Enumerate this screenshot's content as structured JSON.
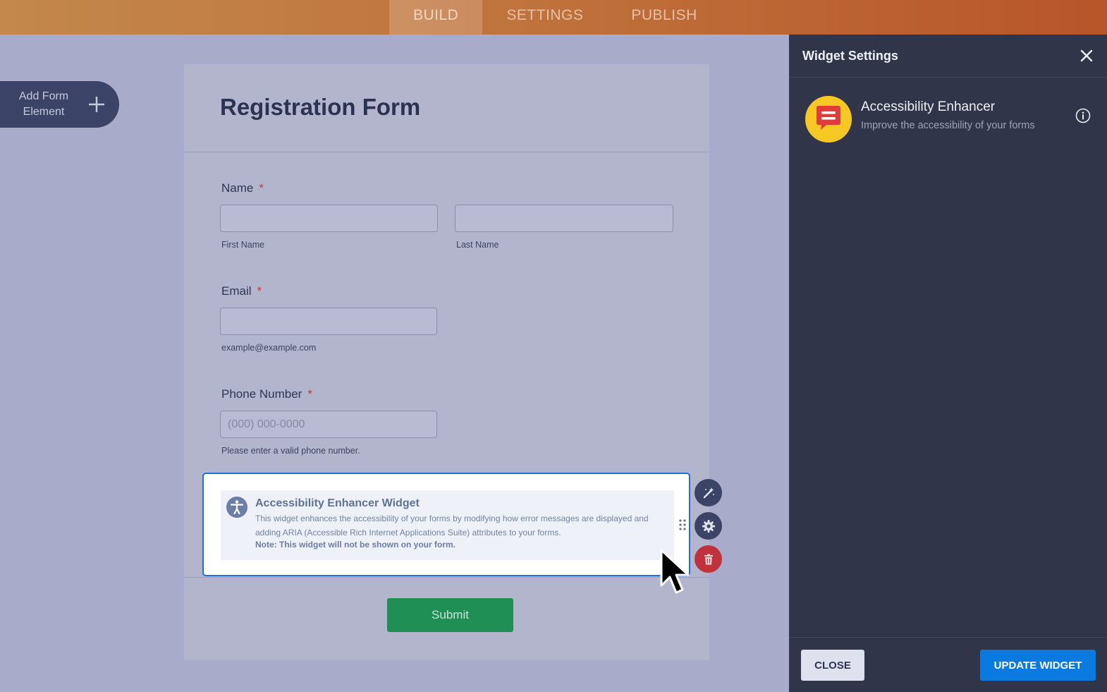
{
  "topbar": {
    "tabs": [
      {
        "label": "BUILD",
        "active": true
      },
      {
        "label": "SETTINGS",
        "active": false
      },
      {
        "label": "PUBLISH",
        "active": false
      }
    ]
  },
  "sidebar": {
    "add_element_label": "Add Form Element",
    "add_icon": "plus-icon"
  },
  "form": {
    "title": "Registration Form",
    "fields": {
      "name": {
        "label": "Name",
        "required_mark": "*",
        "first_sublabel": "First Name",
        "last_sublabel": "Last Name",
        "first_value": "",
        "last_value": ""
      },
      "email": {
        "label": "Email",
        "required_mark": "*",
        "sublabel": "example@example.com",
        "value": ""
      },
      "phone": {
        "label": "Phone Number",
        "required_mark": "*",
        "placeholder": "(000) 000-0000",
        "sublabel": "Please enter a valid phone number.",
        "value": ""
      }
    },
    "widget": {
      "title": "Accessibility Enhancer Widget",
      "description": "This widget enhances the accessibility of your forms by modifying how error messages are displayed and adding ARIA (Accessible Rich Internet Applications Suite) attributes to your forms.",
      "note": "Note: This widget will not be shown on your form.",
      "icon": "accessibility-icon"
    },
    "widget_actions": [
      "magic-wand-icon",
      "gear-icon",
      "trash-icon"
    ],
    "submit_label": "Submit"
  },
  "panel": {
    "title": "Widget Settings",
    "app_name": "Accessibility Enhancer",
    "app_description": "Improve the accessibility of your forms",
    "close_label": "CLOSE",
    "update_label": "UPDATE WIDGET"
  },
  "colors": {
    "accent_blue": "#0a7ae0",
    "submit_green": "#1f8f56",
    "delete_red": "#c0323c",
    "panel_bg": "#313549",
    "logo_yellow": "#f5c824"
  }
}
